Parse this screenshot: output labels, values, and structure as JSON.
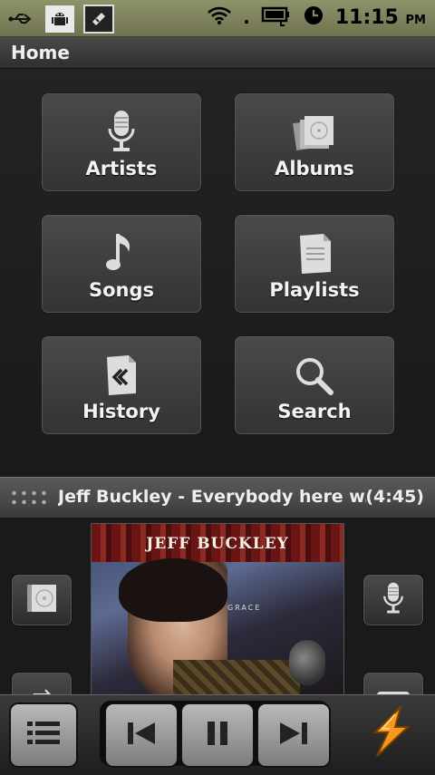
{
  "status_bar": {
    "time": "11:15",
    "ampm": "PM",
    "icons": [
      "usb-icon",
      "android-debug-icon",
      "app-notification-icon",
      "wifi-icon",
      "battery-charging-icon",
      "alarm-clock-icon"
    ]
  },
  "title_bar": {
    "title": "Home"
  },
  "home_grid": {
    "tiles": [
      {
        "label": "Artists",
        "icon": "microphone-icon"
      },
      {
        "label": "Albums",
        "icon": "album-stack-icon"
      },
      {
        "label": "Songs",
        "icon": "music-note-icon"
      },
      {
        "label": "Playlists",
        "icon": "playlist-document-icon"
      },
      {
        "label": "History",
        "icon": "history-rewind-icon"
      },
      {
        "label": "Search",
        "icon": "magnifier-icon"
      }
    ]
  },
  "now_playing": {
    "title": "Jeff Buckley - Everybody here w...",
    "duration": "(4:45)"
  },
  "album_art": {
    "artist_text": "JEFF BUCKLEY",
    "album_text": "GRACE"
  },
  "controls": {
    "buttons": [
      "list-icon",
      "previous-icon",
      "pause-icon",
      "next-icon",
      "winamp-logo-icon"
    ]
  },
  "colors": {
    "status_bar": "#808458",
    "background": "#1b1b1b",
    "tile": "#3f3f3f",
    "control_button": "#a0a0a0",
    "logo_orange": "#f39a1e"
  }
}
